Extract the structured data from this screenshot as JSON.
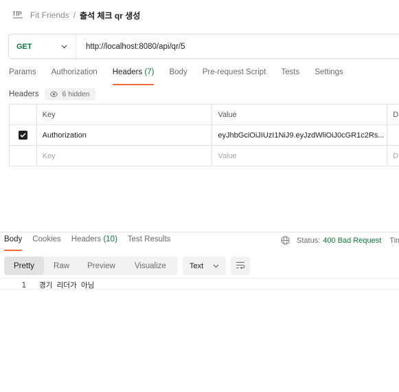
{
  "breadcrumb": {
    "icon": "http-icon",
    "collection": "Fit Friends",
    "separator": "/",
    "request_name": "출석 체크 qr 생성"
  },
  "url_bar": {
    "method": "GET",
    "url": "http://localhost:8080/api/qr/5"
  },
  "request_tabs": [
    {
      "label": "Params"
    },
    {
      "label": "Authorization"
    },
    {
      "label": "Headers",
      "count": "(7)",
      "active": true
    },
    {
      "label": "Body"
    },
    {
      "label": "Pre-request Script"
    },
    {
      "label": "Tests"
    },
    {
      "label": "Settings"
    }
  ],
  "headers_section": {
    "label": "Headers",
    "hidden_pill": "6 hidden"
  },
  "headers_table": {
    "columns": [
      "Key",
      "Value",
      "D"
    ],
    "rows": [
      {
        "checked": true,
        "key": "Authorization",
        "value": "eyJhbGciOiJIUzI1NiJ9.eyJzdWliOiJ0cGR1c2Rs..."
      }
    ],
    "empty_row": {
      "key_placeholder": "Key",
      "value_placeholder": "Value",
      "desc_placeholder": "D"
    }
  },
  "response": {
    "tabs": [
      {
        "label": "Body",
        "active": true
      },
      {
        "label": "Cookies"
      },
      {
        "label": "Headers",
        "count": "(10)"
      },
      {
        "label": "Test Results"
      }
    ],
    "status_label": "Status:",
    "status_value": "400 Bad Request",
    "time_label": "Tim",
    "views": [
      "Pretty",
      "Raw",
      "Preview",
      "Visualize"
    ],
    "active_view": "Pretty",
    "language": "Text",
    "body_lines": [
      {
        "number": "1",
        "text": "경기 리더가 아님"
      }
    ]
  },
  "colors": {
    "accent": "#f26b3a",
    "method_get": "#0b7a39",
    "status_error": "#0b7a39"
  }
}
